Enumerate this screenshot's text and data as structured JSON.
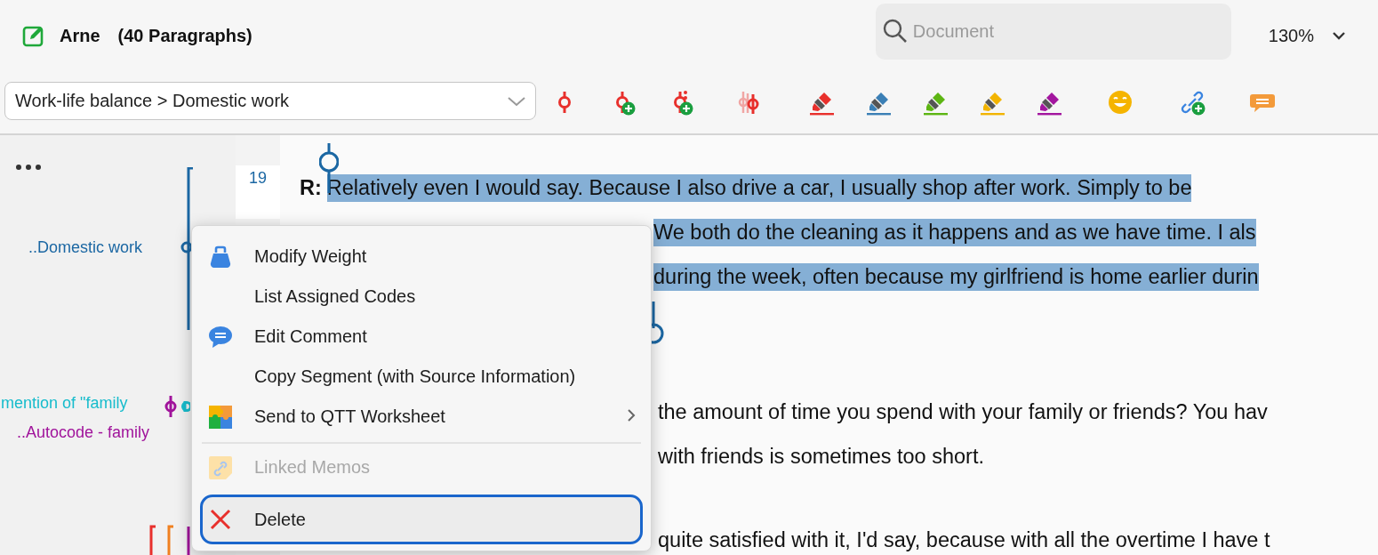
{
  "header": {
    "title": "Arne",
    "count": "(40 Paragraphs)"
  },
  "search": {
    "placeholder": "Document"
  },
  "zoom": {
    "value": "130%"
  },
  "code_selector": {
    "value": "Work-life balance > Domestic work"
  },
  "highlighters": [
    {
      "color": "#e8302c"
    },
    {
      "color": "#3b7fb5"
    },
    {
      "color": "#5db513"
    },
    {
      "color": "#f2b400"
    },
    {
      "color": "#a3169f"
    }
  ],
  "margin_codes": [
    {
      "label": "..Domestic work",
      "color": "#1b67a3"
    },
    {
      "label": "mention of \"family",
      "color": "#17bccc"
    },
    {
      "label": "..Autocode - family",
      "color": "#a0139b"
    }
  ],
  "paragraph_number": "19",
  "lines": [
    {
      "speaker": "R:",
      "text": "Relatively even I would say. Because I also drive a car, I usually shop after work. Simply to be",
      "highlighted": true
    },
    {
      "text": "We both do the cleaning as it happens and as we have time. I als",
      "highlighted": true
    },
    {
      "text": "during the week, often because my girlfriend is home earlier durin",
      "highlighted": true
    },
    {
      "text": "the amount of time you spend with your family or friends? You hav",
      "highlighted": false
    },
    {
      "text": "with friends is sometimes too short.",
      "highlighted": false
    },
    {
      "text": "quite satisfied with it, I'd say, because with all the overtime I have t",
      "highlighted": false
    }
  ],
  "context_menu": [
    {
      "kind": "weight",
      "label": "Modify Weight",
      "disabled": false,
      "focused": false
    },
    {
      "kind": "plain",
      "label": "List Assigned Codes",
      "disabled": false,
      "focused": false
    },
    {
      "kind": "comment",
      "label": "Edit Comment",
      "disabled": false,
      "focused": false
    },
    {
      "kind": "plain",
      "label": "Copy Segment (with Source Information)",
      "disabled": false,
      "focused": false
    },
    {
      "kind": "puzzle",
      "label": "Send to QTT Worksheet",
      "disabled": false,
      "focused": false,
      "submenu": true
    },
    {
      "kind": "separator"
    },
    {
      "kind": "memo",
      "label": "Linked Memos",
      "disabled": true,
      "focused": false
    },
    {
      "kind": "delete",
      "label": "Delete",
      "disabled": false,
      "focused": true
    }
  ]
}
